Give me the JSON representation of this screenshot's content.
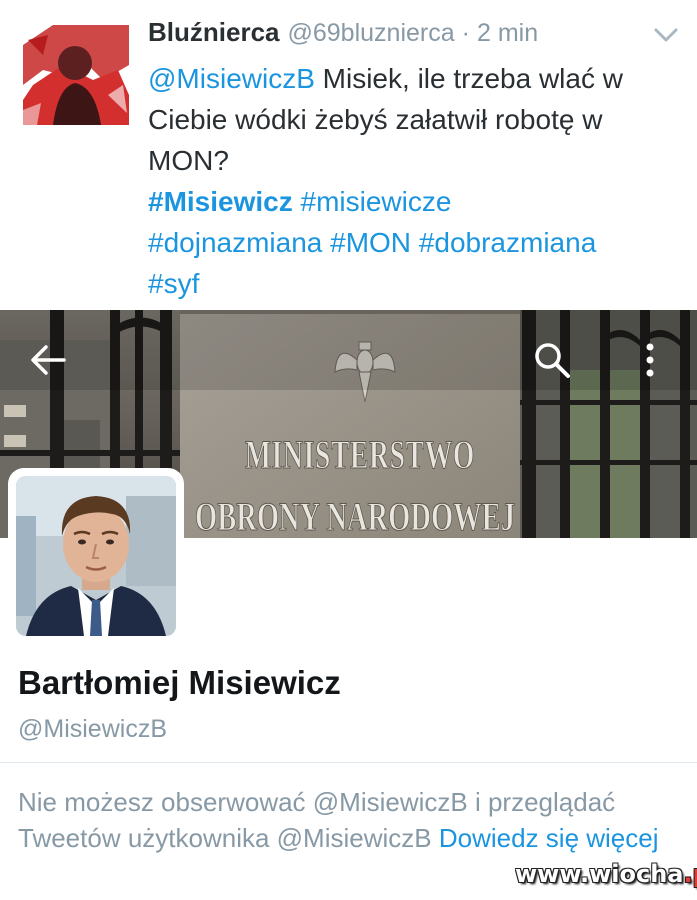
{
  "tweet": {
    "author_name": "Bluźnierca",
    "author_handle": "@69bluznierca",
    "separator": "·",
    "time": "2 min",
    "mention": "@MisiewiczB",
    "text": " Misiek, ile trzeba wlać w Ciebie wódki żebyś załatwił robotę w MON?",
    "hashtags": [
      {
        "text": "#Misiewicz",
        "bold": true
      },
      {
        "text": "#misiewicze",
        "bold": false
      },
      {
        "text": "#dojnazmiana",
        "bold": false
      },
      {
        "text": "#MON",
        "bold": false
      },
      {
        "text": "#dobrazmiana",
        "bold": false
      },
      {
        "text": "#syf",
        "bold": false
      }
    ]
  },
  "profile": {
    "banner_sign_line1": "MINISTERSTWO",
    "banner_sign_line2": "OBRONY NARODOWEJ",
    "name": "Bartłomiej Misiewicz",
    "handle": "@MisiewiczB",
    "protected_text_part1": "Nie możesz obserwować @MisiewiczB i przeglądać Tweetów użytkownika @MisiewiczB ",
    "learn_more_link": "Dowiedz się więcej"
  },
  "watermark": {
    "part1": "www.wiocha",
    "part2": ".pl"
  },
  "icons": {
    "back": "arrow-left-icon",
    "search": "search-icon",
    "more": "more-vertical-icon",
    "caret": "chevron-down-icon"
  },
  "colors": {
    "link": "#1b95e0",
    "secondary_text": "#8899a6",
    "primary_text": "#292f33"
  }
}
